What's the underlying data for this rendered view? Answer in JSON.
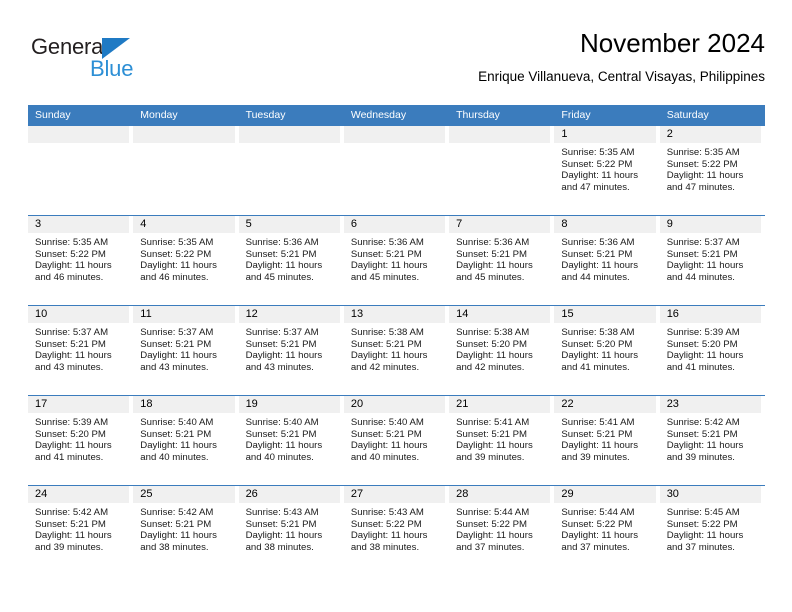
{
  "brand": {
    "name_top": "General",
    "name_bottom": "Blue",
    "triangle_color": "#1f7ac4",
    "blue_text_color": "#2d8fd5",
    "top_text_color": "#231f20"
  },
  "header": {
    "month_title": "November 2024",
    "location": "Enrique Villanueva, Central Visayas, Philippines",
    "accent_color": "#3b7cbd"
  },
  "calendar": {
    "weekday_headers": [
      "Sunday",
      "Monday",
      "Tuesday",
      "Wednesday",
      "Thursday",
      "Friday",
      "Saturday"
    ],
    "daynum_strip_color": "#f0f0f0",
    "weeks": [
      [
        {
          "day": "",
          "blank": true
        },
        {
          "day": "",
          "blank": true
        },
        {
          "day": "",
          "blank": true
        },
        {
          "day": "",
          "blank": true
        },
        {
          "day": "",
          "blank": true
        },
        {
          "day": "1",
          "sunrise": "Sunrise: 5:35 AM",
          "sunset": "Sunset: 5:22 PM",
          "daylight": "Daylight: 11 hours and 47 minutes."
        },
        {
          "day": "2",
          "sunrise": "Sunrise: 5:35 AM",
          "sunset": "Sunset: 5:22 PM",
          "daylight": "Daylight: 11 hours and 47 minutes."
        }
      ],
      [
        {
          "day": "3",
          "sunrise": "Sunrise: 5:35 AM",
          "sunset": "Sunset: 5:22 PM",
          "daylight": "Daylight: 11 hours and 46 minutes."
        },
        {
          "day": "4",
          "sunrise": "Sunrise: 5:35 AM",
          "sunset": "Sunset: 5:22 PM",
          "daylight": "Daylight: 11 hours and 46 minutes."
        },
        {
          "day": "5",
          "sunrise": "Sunrise: 5:36 AM",
          "sunset": "Sunset: 5:21 PM",
          "daylight": "Daylight: 11 hours and 45 minutes."
        },
        {
          "day": "6",
          "sunrise": "Sunrise: 5:36 AM",
          "sunset": "Sunset: 5:21 PM",
          "daylight": "Daylight: 11 hours and 45 minutes."
        },
        {
          "day": "7",
          "sunrise": "Sunrise: 5:36 AM",
          "sunset": "Sunset: 5:21 PM",
          "daylight": "Daylight: 11 hours and 45 minutes."
        },
        {
          "day": "8",
          "sunrise": "Sunrise: 5:36 AM",
          "sunset": "Sunset: 5:21 PM",
          "daylight": "Daylight: 11 hours and 44 minutes."
        },
        {
          "day": "9",
          "sunrise": "Sunrise: 5:37 AM",
          "sunset": "Sunset: 5:21 PM",
          "daylight": "Daylight: 11 hours and 44 minutes."
        }
      ],
      [
        {
          "day": "10",
          "sunrise": "Sunrise: 5:37 AM",
          "sunset": "Sunset: 5:21 PM",
          "daylight": "Daylight: 11 hours and 43 minutes."
        },
        {
          "day": "11",
          "sunrise": "Sunrise: 5:37 AM",
          "sunset": "Sunset: 5:21 PM",
          "daylight": "Daylight: 11 hours and 43 minutes."
        },
        {
          "day": "12",
          "sunrise": "Sunrise: 5:37 AM",
          "sunset": "Sunset: 5:21 PM",
          "daylight": "Daylight: 11 hours and 43 minutes."
        },
        {
          "day": "13",
          "sunrise": "Sunrise: 5:38 AM",
          "sunset": "Sunset: 5:21 PM",
          "daylight": "Daylight: 11 hours and 42 minutes."
        },
        {
          "day": "14",
          "sunrise": "Sunrise: 5:38 AM",
          "sunset": "Sunset: 5:20 PM",
          "daylight": "Daylight: 11 hours and 42 minutes."
        },
        {
          "day": "15",
          "sunrise": "Sunrise: 5:38 AM",
          "sunset": "Sunset: 5:20 PM",
          "daylight": "Daylight: 11 hours and 41 minutes."
        },
        {
          "day": "16",
          "sunrise": "Sunrise: 5:39 AM",
          "sunset": "Sunset: 5:20 PM",
          "daylight": "Daylight: 11 hours and 41 minutes."
        }
      ],
      [
        {
          "day": "17",
          "sunrise": "Sunrise: 5:39 AM",
          "sunset": "Sunset: 5:20 PM",
          "daylight": "Daylight: 11 hours and 41 minutes."
        },
        {
          "day": "18",
          "sunrise": "Sunrise: 5:40 AM",
          "sunset": "Sunset: 5:21 PM",
          "daylight": "Daylight: 11 hours and 40 minutes."
        },
        {
          "day": "19",
          "sunrise": "Sunrise: 5:40 AM",
          "sunset": "Sunset: 5:21 PM",
          "daylight": "Daylight: 11 hours and 40 minutes."
        },
        {
          "day": "20",
          "sunrise": "Sunrise: 5:40 AM",
          "sunset": "Sunset: 5:21 PM",
          "daylight": "Daylight: 11 hours and 40 minutes."
        },
        {
          "day": "21",
          "sunrise": "Sunrise: 5:41 AM",
          "sunset": "Sunset: 5:21 PM",
          "daylight": "Daylight: 11 hours and 39 minutes."
        },
        {
          "day": "22",
          "sunrise": "Sunrise: 5:41 AM",
          "sunset": "Sunset: 5:21 PM",
          "daylight": "Daylight: 11 hours and 39 minutes."
        },
        {
          "day": "23",
          "sunrise": "Sunrise: 5:42 AM",
          "sunset": "Sunset: 5:21 PM",
          "daylight": "Daylight: 11 hours and 39 minutes."
        }
      ],
      [
        {
          "day": "24",
          "sunrise": "Sunrise: 5:42 AM",
          "sunset": "Sunset: 5:21 PM",
          "daylight": "Daylight: 11 hours and 39 minutes."
        },
        {
          "day": "25",
          "sunrise": "Sunrise: 5:42 AM",
          "sunset": "Sunset: 5:21 PM",
          "daylight": "Daylight: 11 hours and 38 minutes."
        },
        {
          "day": "26",
          "sunrise": "Sunrise: 5:43 AM",
          "sunset": "Sunset: 5:21 PM",
          "daylight": "Daylight: 11 hours and 38 minutes."
        },
        {
          "day": "27",
          "sunrise": "Sunrise: 5:43 AM",
          "sunset": "Sunset: 5:22 PM",
          "daylight": "Daylight: 11 hours and 38 minutes."
        },
        {
          "day": "28",
          "sunrise": "Sunrise: 5:44 AM",
          "sunset": "Sunset: 5:22 PM",
          "daylight": "Daylight: 11 hours and 37 minutes."
        },
        {
          "day": "29",
          "sunrise": "Sunrise: 5:44 AM",
          "sunset": "Sunset: 5:22 PM",
          "daylight": "Daylight: 11 hours and 37 minutes."
        },
        {
          "day": "30",
          "sunrise": "Sunrise: 5:45 AM",
          "sunset": "Sunset: 5:22 PM",
          "daylight": "Daylight: 11 hours and 37 minutes."
        }
      ]
    ]
  }
}
